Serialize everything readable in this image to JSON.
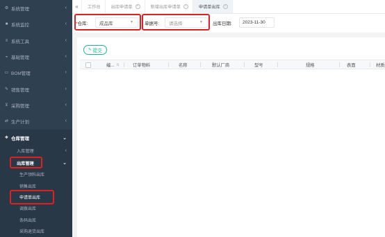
{
  "sidebar": {
    "items": [
      {
        "label": "系统管理",
        "icon": "gear-icon"
      },
      {
        "label": "系统监控",
        "icon": "video-icon"
      },
      {
        "label": "系统工具",
        "icon": "bars-icon"
      },
      {
        "label": "基础管理",
        "icon": "car-icon"
      },
      {
        "label": "BOM管理",
        "icon": "laptop-icon"
      },
      {
        "label": "销售管理",
        "icon": "edit-icon"
      },
      {
        "label": "采购管理",
        "icon": "cart-icon"
      },
      {
        "label": "生产计划",
        "icon": "exchange-icon"
      },
      {
        "label": "仓库管理",
        "icon": "cubes-icon"
      }
    ],
    "sub_items": [
      {
        "label": "入库管理"
      },
      {
        "label": "出库管理"
      }
    ],
    "sub2_items": [
      {
        "label": "生产领料出库"
      },
      {
        "label": "销售出库"
      },
      {
        "label": "申请单出库"
      },
      {
        "label": "调拨出库"
      },
      {
        "label": "条码出库"
      },
      {
        "label": "采购退货出库"
      }
    ]
  },
  "tabs": {
    "back_icon": "«",
    "items": [
      {
        "label": "工作台",
        "closable": false
      },
      {
        "label": "出库申请单",
        "closable": true
      },
      {
        "label": "新增出库申请单",
        "closable": true
      },
      {
        "label": "申请单出库",
        "closable": true,
        "active": true
      }
    ]
  },
  "filters": {
    "warehouse_label": "仓库:",
    "warehouse_required": "*",
    "warehouse_value": "成品库",
    "doc_no_label": "单据号:",
    "doc_no_placeholder": "请选择",
    "date_label": "出库日期:",
    "date_value": "2023-11-30"
  },
  "toolbar": {
    "submit_label": "提交"
  },
  "table": {
    "columns": [
      "编...",
      "订单物料",
      "名称",
      "默认厂商",
      "型号",
      "规格",
      "表面",
      "材质"
    ]
  },
  "colors": {
    "sidebar_bg": "#2f4050",
    "accent": "#1ab394",
    "highlight": "#e02020"
  }
}
